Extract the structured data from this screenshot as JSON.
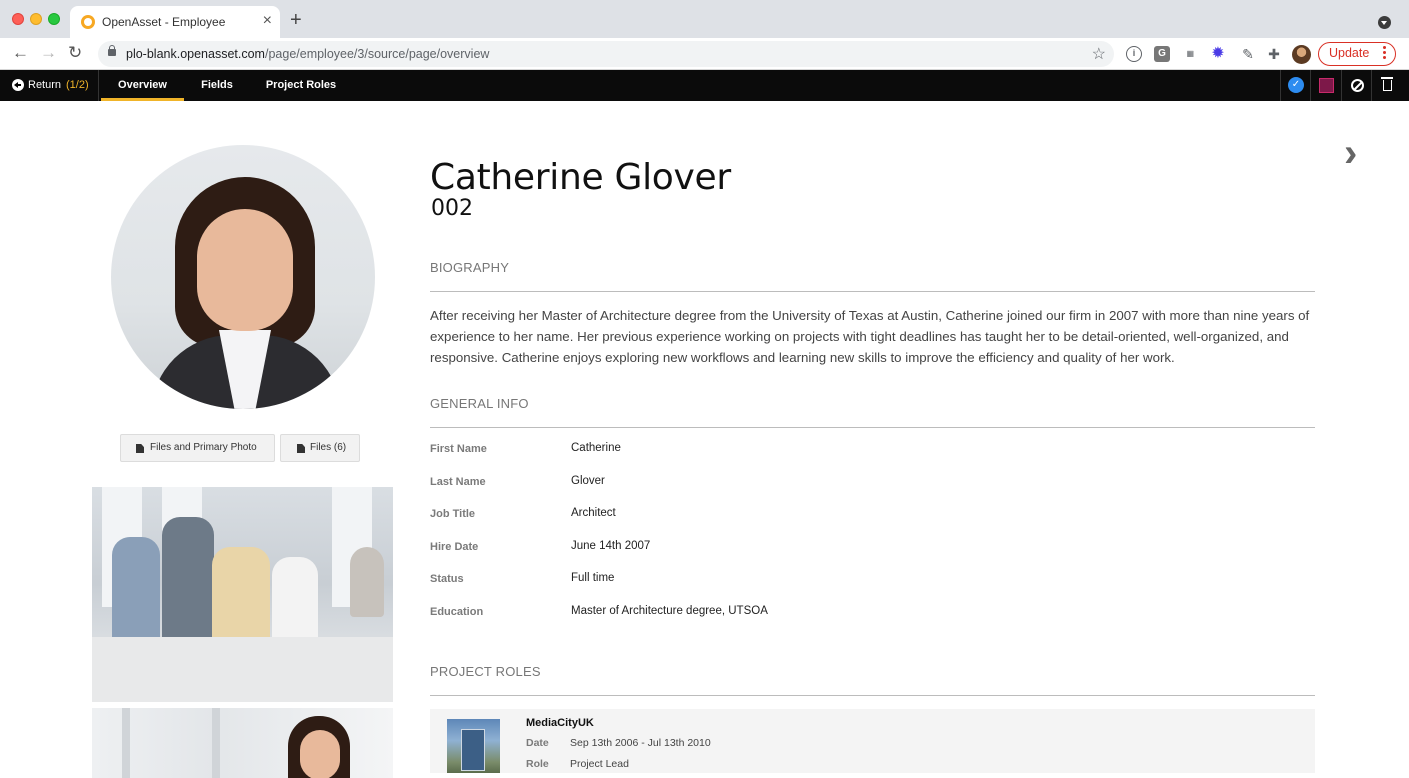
{
  "browser": {
    "tab_title": "OpenAsset - Employee",
    "close_glyph": "×",
    "new_tab_glyph": "+",
    "url_host": "plo-blank.openasset.com",
    "url_path": "/page/employee/3/source/page/overview",
    "update_label": "Update",
    "ext_icons": [
      "info-icon",
      "grammarly-icon",
      "ms-extension-icon",
      "gear-extension-icon",
      "pen-extension-icon",
      "puzzle-icon"
    ]
  },
  "appbar": {
    "return_label": "Return",
    "return_count": "(1/2)",
    "tabs": [
      {
        "label": "Overview",
        "active": true
      },
      {
        "label": "Fields",
        "active": false
      },
      {
        "label": "Project Roles",
        "active": false
      }
    ],
    "accent_color": "#f0b429"
  },
  "employee": {
    "name": "Catherine Glover",
    "code": "002"
  },
  "photo_buttons": {
    "files_and_primary_photo": "Files and Primary Photo",
    "files": "Files (6)"
  },
  "biography": {
    "title": "BIOGRAPHY",
    "text": "After receiving her Master of Architecture degree from the University of Texas at Austin, Catherine joined our firm in 2007 with more than nine years of experience to her name. Her previous experience working on projects with tight deadlines has taught her to be detail-oriented, well-organized, and responsive. Catherine enjoys exploring new workflows and learning new skills to improve the efficiency and quality of her work."
  },
  "general_info": {
    "title": "GENERAL INFO",
    "fields": [
      {
        "label": "First Name",
        "value": "Catherine"
      },
      {
        "label": "Last Name",
        "value": "Glover"
      },
      {
        "label": "Job Title",
        "value": "Architect"
      },
      {
        "label": "Hire Date",
        "value": "June 14th 2007"
      },
      {
        "label": "Status",
        "value": "Full time"
      },
      {
        "label": "Education",
        "value": "Master of Architecture degree, UTSOA"
      }
    ]
  },
  "project_roles": {
    "title": "PROJECT ROLES",
    "items": [
      {
        "project": "MediaCityUK",
        "date_label": "Date",
        "date_value": "Sep 13th 2006 - Jul 13th 2010",
        "role_label": "Role",
        "role_value": "Project Lead"
      }
    ]
  }
}
